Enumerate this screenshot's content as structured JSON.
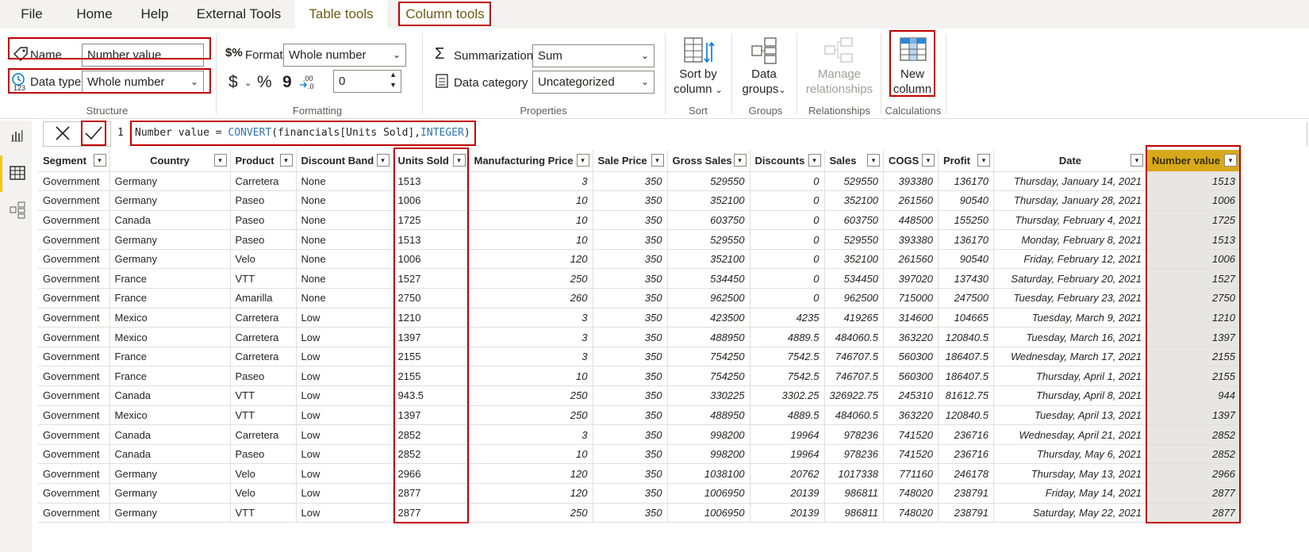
{
  "tabs": [
    {
      "label": "File"
    },
    {
      "label": "Home"
    },
    {
      "label": "Help"
    },
    {
      "label": "External Tools"
    },
    {
      "label": "Table tools"
    },
    {
      "label": "Column tools"
    }
  ],
  "structure": {
    "name_label": "Name",
    "name_value": "Number value",
    "datatype_label": "Data type",
    "datatype_value": "Whole number",
    "group_label": "Structure"
  },
  "formatting": {
    "format_label": "Format",
    "format_value": "Whole number",
    "currency_symbol": "$",
    "percent_symbol": "%",
    "comma_symbol": "9",
    "decimals_value": "0",
    "group_label": "Formatting"
  },
  "properties": {
    "summarization_label": "Summarization",
    "summarization_value": "Sum",
    "category_label": "Data category",
    "category_value": "Uncategorized",
    "group_label": "Properties"
  },
  "sort": {
    "line1": "Sort by",
    "line2": "column",
    "group_label": "Sort"
  },
  "groups": {
    "line1": "Data",
    "line2": "groups",
    "group_label": "Groups"
  },
  "relationships": {
    "line1": "Manage",
    "line2": "relationships",
    "group_label": "Relationships"
  },
  "calculations": {
    "line1": "New",
    "line2": "column",
    "group_label": "Calculations"
  },
  "formula": {
    "line_number": "1",
    "prefix": "Number value = ",
    "func": "CONVERT",
    "args_open": "(financials[Units Sold],",
    "type_kw": "INTEGER",
    "args_close": ")"
  },
  "columns": [
    "Segment",
    "Country",
    "Product",
    "Discount Band",
    "Units Sold",
    "Manufacturing Price",
    "Sale Price",
    "Gross Sales",
    "Discounts",
    "Sales",
    "COGS",
    "Profit",
    "Date",
    "Number value"
  ],
  "rows": [
    [
      "Government",
      "Germany",
      "Carretera",
      "None",
      "1513",
      "3",
      "350",
      "529550",
      "0",
      "529550",
      "393380",
      "136170",
      "Thursday, January 14, 2021",
      "1513"
    ],
    [
      "Government",
      "Germany",
      "Paseo",
      "None",
      "1006",
      "10",
      "350",
      "352100",
      "0",
      "352100",
      "261560",
      "90540",
      "Thursday, January 28, 2021",
      "1006"
    ],
    [
      "Government",
      "Canada",
      "Paseo",
      "None",
      "1725",
      "10",
      "350",
      "603750",
      "0",
      "603750",
      "448500",
      "155250",
      "Thursday, February 4, 2021",
      "1725"
    ],
    [
      "Government",
      "Germany",
      "Paseo",
      "None",
      "1513",
      "10",
      "350",
      "529550",
      "0",
      "529550",
      "393380",
      "136170",
      "Monday, February 8, 2021",
      "1513"
    ],
    [
      "Government",
      "Germany",
      "Velo",
      "None",
      "1006",
      "120",
      "350",
      "352100",
      "0",
      "352100",
      "261560",
      "90540",
      "Friday, February 12, 2021",
      "1006"
    ],
    [
      "Government",
      "France",
      "VTT",
      "None",
      "1527",
      "250",
      "350",
      "534450",
      "0",
      "534450",
      "397020",
      "137430",
      "Saturday, February 20, 2021",
      "1527"
    ],
    [
      "Government",
      "France",
      "Amarilla",
      "None",
      "2750",
      "260",
      "350",
      "962500",
      "0",
      "962500",
      "715000",
      "247500",
      "Tuesday, February 23, 2021",
      "2750"
    ],
    [
      "Government",
      "Mexico",
      "Carretera",
      "Low",
      "1210",
      "3",
      "350",
      "423500",
      "4235",
      "419265",
      "314600",
      "104665",
      "Tuesday, March 9, 2021",
      "1210"
    ],
    [
      "Government",
      "Mexico",
      "Carretera",
      "Low",
      "1397",
      "3",
      "350",
      "488950",
      "4889.5",
      "484060.5",
      "363220",
      "120840.5",
      "Tuesday, March 16, 2021",
      "1397"
    ],
    [
      "Government",
      "France",
      "Carretera",
      "Low",
      "2155",
      "3",
      "350",
      "754250",
      "7542.5",
      "746707.5",
      "560300",
      "186407.5",
      "Wednesday, March 17, 2021",
      "2155"
    ],
    [
      "Government",
      "France",
      "Paseo",
      "Low",
      "2155",
      "10",
      "350",
      "754250",
      "7542.5",
      "746707.5",
      "560300",
      "186407.5",
      "Thursday, April 1, 2021",
      "2155"
    ],
    [
      "Government",
      "Canada",
      "VTT",
      "Low",
      "943.5",
      "250",
      "350",
      "330225",
      "3302.25",
      "326922.75",
      "245310",
      "81612.75",
      "Thursday, April 8, 2021",
      "944"
    ],
    [
      "Government",
      "Mexico",
      "VTT",
      "Low",
      "1397",
      "250",
      "350",
      "488950",
      "4889.5",
      "484060.5",
      "363220",
      "120840.5",
      "Tuesday, April 13, 2021",
      "1397"
    ],
    [
      "Government",
      "Canada",
      "Carretera",
      "Low",
      "2852",
      "3",
      "350",
      "998200",
      "19964",
      "978236",
      "741520",
      "236716",
      "Wednesday, April 21, 2021",
      "2852"
    ],
    [
      "Government",
      "Canada",
      "Paseo",
      "Low",
      "2852",
      "10",
      "350",
      "998200",
      "19964",
      "978236",
      "741520",
      "236716",
      "Thursday, May 6, 2021",
      "2852"
    ],
    [
      "Government",
      "Germany",
      "Velo",
      "Low",
      "2966",
      "120",
      "350",
      "1038100",
      "20762",
      "1017338",
      "771160",
      "246178",
      "Thursday, May 13, 2021",
      "2966"
    ],
    [
      "Government",
      "Germany",
      "Velo",
      "Low",
      "2877",
      "120",
      "350",
      "1006950",
      "20139",
      "986811",
      "748020",
      "238791",
      "Friday, May 14, 2021",
      "2877"
    ],
    [
      "Government",
      "Germany",
      "VTT",
      "Low",
      "2877",
      "250",
      "350",
      "1006950",
      "20139",
      "986811",
      "748020",
      "238791",
      "Saturday, May 22, 2021",
      "2877"
    ]
  ],
  "colors": {
    "accent_gold": "#d7a91a",
    "highlight_red": "#c00000",
    "dax_blue": "#2e75b6"
  }
}
